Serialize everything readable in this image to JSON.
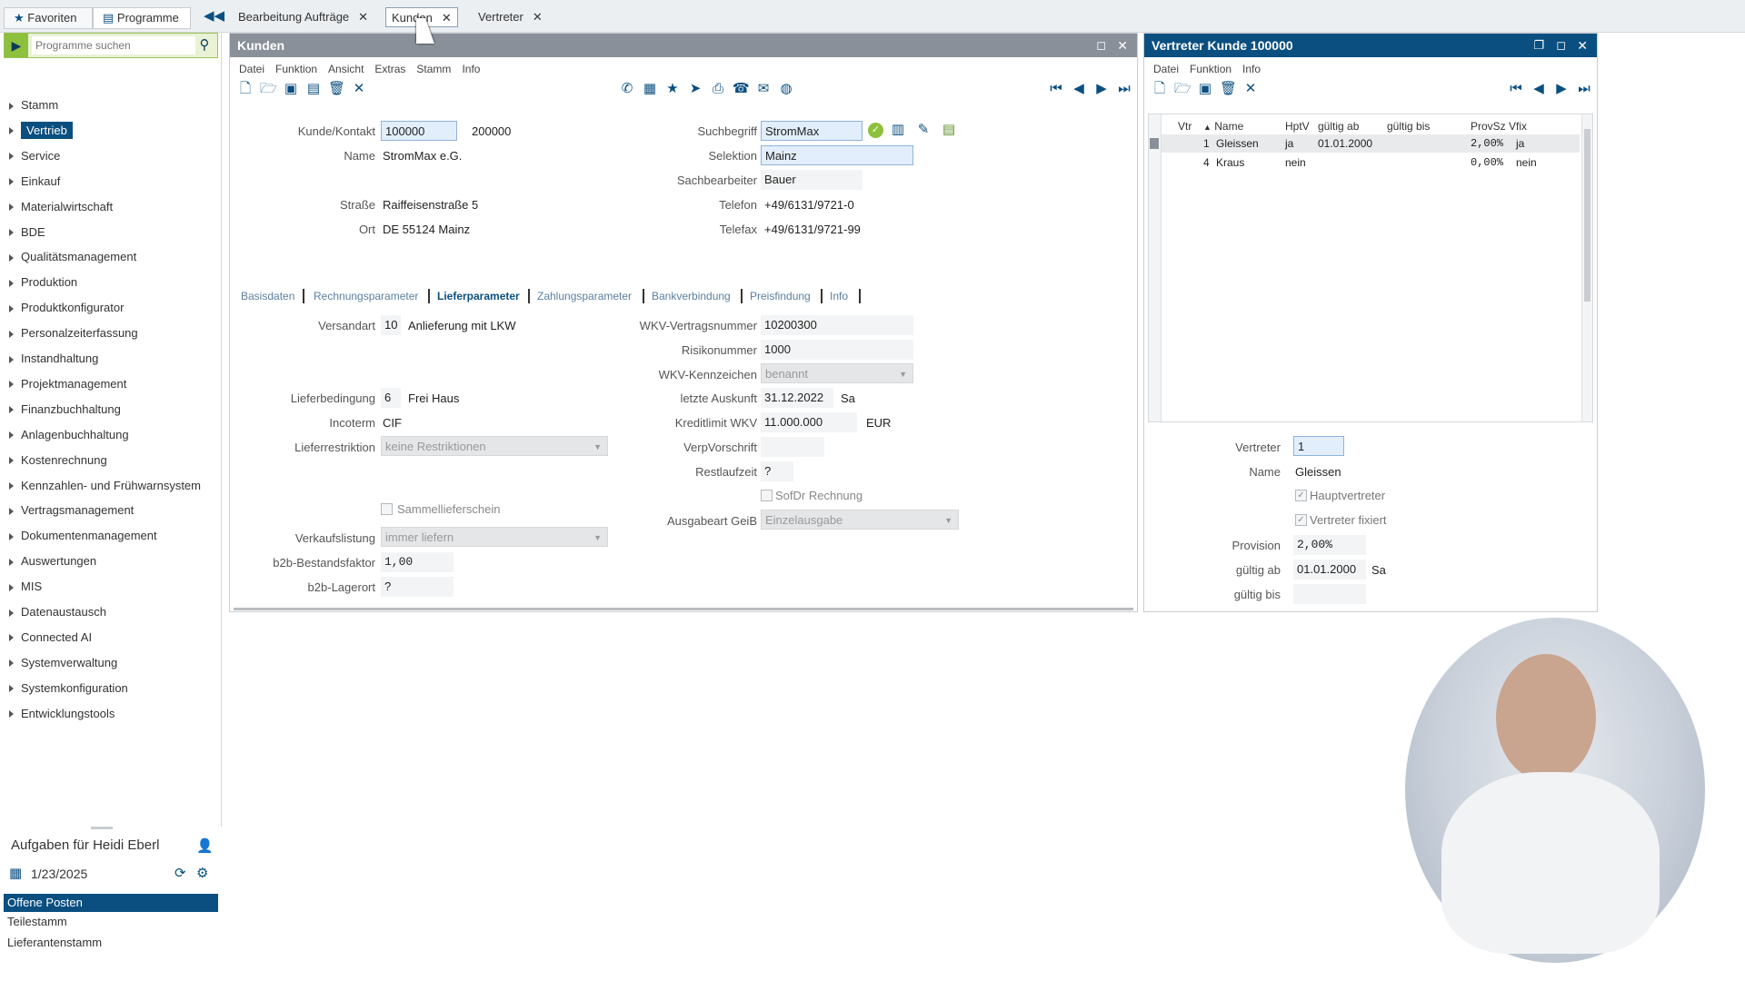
{
  "topbar": {
    "favorites": "Favoriten",
    "programs": "Programme",
    "tabs": [
      {
        "label": "Bearbeitung Aufträge"
      },
      {
        "label": "Kunden"
      },
      {
        "label": "Vertreter"
      }
    ]
  },
  "sidebar": {
    "search_placeholder": "Programme suchen",
    "items": [
      "Stamm",
      "Vertrieb",
      "Service",
      "Einkauf",
      "Materialwirtschaft",
      "BDE",
      "Qualitätsmanagement",
      "Produktion",
      "Produktkonfigurator",
      "Personalzeiterfassung",
      "Instandhaltung",
      "Projektmanagement",
      "Finanzbuchhaltung",
      "Anlagenbuchhaltung",
      "Kostenrechnung",
      "Kennzahlen- und Frühwarnsystem",
      "Vertragsmanagement",
      "Dokumentenmanagement",
      "Auswertungen",
      "MIS",
      "Datenaustausch",
      "Connected AI",
      "Systemverwaltung",
      "Systemkonfiguration",
      "Entwicklungstools"
    ],
    "selected": "Vertrieb"
  },
  "tasks": {
    "title": "Aufgaben für Heidi Eberl",
    "date": "1/23/2025",
    "items": [
      "Offene Posten",
      "Teilestamm",
      "Lieferantenstamm"
    ]
  },
  "kunden": {
    "title": "Kunden",
    "menu": [
      "Datei",
      "Funktion",
      "Ansicht",
      "Extras",
      "Stamm",
      "Info"
    ],
    "labels": {
      "kunde": "Kunde/Kontakt",
      "name": "Name",
      "strasse": "Straße",
      "ort": "Ort",
      "suchbegriff": "Suchbegriff",
      "selektion": "Selektion",
      "sachbearbeiter": "Sachbearbeiter",
      "telefon": "Telefon",
      "telefax": "Telefax"
    },
    "values": {
      "kunde": "100000",
      "kontakt": "200000",
      "name": "StromMax e.G.",
      "strasse": "Raiffeisenstraße 5",
      "ort": "DE 55124 Mainz",
      "suchbegriff": "StromMax",
      "selektion": "Mainz",
      "sachbearbeiter": "Bauer",
      "telefon": "+49/6131/9721-0",
      "telefax": "+49/6131/9721-99"
    },
    "subtabs": [
      "Basisdaten",
      "Rechnungsparameter",
      "Lieferparameter",
      "Zahlungsparameter",
      "Bankverbindung",
      "Preisfindung",
      "Info"
    ],
    "selected_subtab": "Lieferparameter",
    "lief": {
      "versandart_label": "Versandart",
      "versandart_code": "10",
      "versandart_text": "Anlieferung mit LKW",
      "lieferbedingung_label": "Lieferbedingung",
      "lieferbedingung_code": "6",
      "lieferbedingung_text": "Frei Haus",
      "incoterm_label": "Incoterm",
      "incoterm_value": "CIF",
      "lieferrestriktion_label": "Lieferrestriktion",
      "lieferrestriktion_value": "keine Restriktionen",
      "sammel_label": "Sammellieferschein",
      "verkaufslistung_label": "Verkaufslistung",
      "verkaufslistung_value": "immer liefern",
      "b2b_faktor_label": "b2b-Bestandsfaktor",
      "b2b_faktor_value": "1,00",
      "b2b_lager_label": "b2b-Lagerort",
      "b2b_lager_value": "?",
      "wkv_nr_label": "WKV-Vertragsnummer",
      "wkv_nr_value": "10200300",
      "risiko_label": "Risikonummer",
      "risiko_value": "1000",
      "wkv_kz_label": "WKV-Kennzeichen",
      "wkv_kz_value": "benannt",
      "auskunft_label": "letzte Auskunft",
      "auskunft_value": "31.12.2022",
      "auskunft_day": "Sa",
      "kredit_label": "Kreditlimit WKV",
      "kredit_value": "11.000.000",
      "kredit_unit": "EUR",
      "verp_label": "VerpVorschrift",
      "verp_value": "",
      "rest_label": "Restlaufzeit",
      "rest_value": "?",
      "sofdr_label": "SofDr Rechnung",
      "ausgabe_label": "Ausgabeart GeiB",
      "ausgabe_value": "Einzelausgabe"
    }
  },
  "vertreter": {
    "title": "Vertreter Kunde 100000",
    "menu": [
      "Datei",
      "Funktion",
      "Info"
    ],
    "columns": [
      "Vtr",
      "Name",
      "HptV",
      "gültig ab",
      "gültig bis",
      "ProvSz",
      "Vfix"
    ],
    "rows": [
      {
        "vtr": "1",
        "name": "Gleissen",
        "hptv": "ja",
        "ab": "01.01.2000",
        "bis": "",
        "prov": "2,00%",
        "vfix": "ja"
      },
      {
        "vtr": "4",
        "name": "Kraus",
        "hptv": "nein",
        "ab": "",
        "bis": "",
        "prov": "0,00%",
        "vfix": "nein"
      }
    ],
    "detail": {
      "vertreter_label": "Vertreter",
      "vertreter_value": "1",
      "name_label": "Name",
      "name_value": "Gleissen",
      "haupt_label": "Hauptvertreter",
      "fixiert_label": "Vertreter fixiert",
      "provision_label": "Provision",
      "provision_value": "2,00%",
      "ab_label": "gültig ab",
      "ab_value": "01.01.2000",
      "ab_day": "Sa",
      "bis_label": "gültig bis",
      "bis_value": ""
    }
  },
  "colors": {
    "header_gray": "#8a9099",
    "header_blue": "#0b4f80",
    "accent_green": "#8dc03c",
    "selected_blue": "#0b4f80"
  }
}
